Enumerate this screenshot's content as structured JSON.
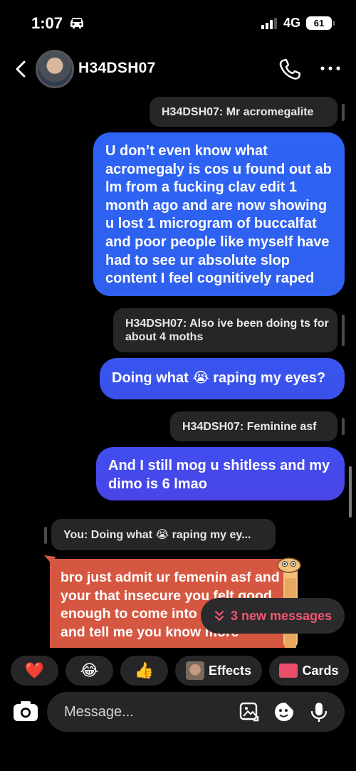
{
  "status_bar": {
    "time": "1:07",
    "network": "4G",
    "battery": "61"
  },
  "header": {
    "contact_name": "H34DSH07"
  },
  "messages": {
    "reply_1": "H34DSH07: Mr acromegalite",
    "msg_1": "U don’t even know what acromegaly is cos u found out ab lm from a fucking clav edit 1 month ago and are now showing u lost 1 microgram of buccalfat and poor people like myself have had to see ur absolute slop content I feel cognitively raped",
    "reply_2": "H34DSH07: Also ive been doing ts for about 4 moths",
    "msg_2": "Doing what 😭 raping my eyes?",
    "reply_3": "H34DSH07: Feminine asf",
    "msg_3": "And I still mog u shitless and my dimo is 6 lmao",
    "reply_4": "You: Doing what 😭 raping my ey...",
    "incoming_1": "bro just admit ur femenin asf and your that insecure you felt good enough to come into my dms and tell me you know more"
  },
  "new_messages_pill": {
    "label": "3 new messages"
  },
  "reactions": {
    "heart": "❤️",
    "laugh": "😂",
    "thumbs_up": "👍",
    "effects_label": "Effects",
    "cards_label": "Cards"
  },
  "composer": {
    "placeholder": "Message..."
  },
  "colors": {
    "accent_blue": "#2f60ee",
    "incoming_card": "#d65741",
    "new_messages_text": "#f0586f",
    "chip_bg": "#262628"
  },
  "icons": [
    "back-chevron-icon",
    "phone-icon",
    "more-icon",
    "camera-icon",
    "gallery-icon",
    "sticker-icon",
    "microphone-icon",
    "double-chevron-down-icon"
  ]
}
